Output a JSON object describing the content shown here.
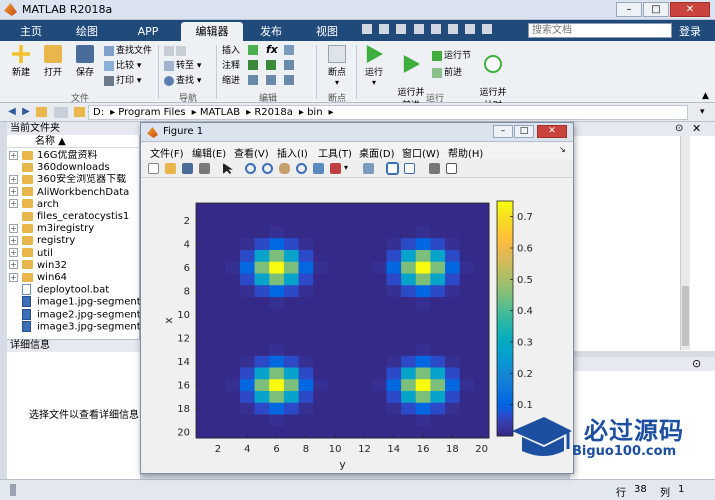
{
  "window": {
    "title": "MATLAB R2018a"
  },
  "tabs": [
    {
      "label": "主页",
      "active": false
    },
    {
      "label": "绘图",
      "active": false
    },
    {
      "label": "APP",
      "active": false
    },
    {
      "label": "编辑器",
      "active": true
    },
    {
      "label": "发布",
      "active": false
    },
    {
      "label": "视图",
      "active": false
    }
  ],
  "search": {
    "placeholder": "搜索文档"
  },
  "login": "登录",
  "ribbon": {
    "new": "新建",
    "open": "打开",
    "save": "保存",
    "find_files": "查找文件",
    "compare": "比较",
    "print": "打印",
    "goto": "转至",
    "find": "查找",
    "insert": "插入",
    "comment": "注释",
    "indent": "缩进",
    "breakpoints": "断点",
    "run": "运行",
    "run_advance": "运行并\n前进",
    "run_section": "运行节",
    "advance": "前进",
    "run_time": "运行并\n计时",
    "groups": {
      "file": "文件",
      "navigate": "导航",
      "edit": "编辑",
      "breakpoints": "断点",
      "run": "运行"
    }
  },
  "address": {
    "path": [
      "D:",
      "Program Files",
      "MATLAB",
      "R2018a",
      "bin"
    ]
  },
  "left_panel": {
    "title": "当前文件夹",
    "col_name": "名称 ▲",
    "items": [
      {
        "name": "16G优盘资料",
        "type": "folder",
        "expand": true
      },
      {
        "name": "360downloads",
        "type": "folder",
        "expand": false
      },
      {
        "name": "360安全浏览器下载",
        "type": "folder",
        "expand": true
      },
      {
        "name": "AliWorkbenchData",
        "type": "folder",
        "expand": true
      },
      {
        "name": "arch",
        "type": "folder",
        "expand": true
      },
      {
        "name": "files_ceratocystis1",
        "type": "folder",
        "expand": false
      },
      {
        "name": "m3iregistry",
        "type": "folder",
        "expand": true
      },
      {
        "name": "registry",
        "type": "folder",
        "expand": true
      },
      {
        "name": "util",
        "type": "folder",
        "expand": true
      },
      {
        "name": "win32",
        "type": "folder",
        "expand": true
      },
      {
        "name": "win64",
        "type": "folder",
        "expand": true
      },
      {
        "name": "deploytool.bat",
        "type": "file",
        "expand": false
      },
      {
        "name": "image1.jpg-segmente...",
        "type": "image",
        "expand": false
      },
      {
        "name": "image2.jpg-segmente...",
        "type": "image",
        "expand": false
      },
      {
        "name": "image3.jpg-segmente...",
        "type": "image",
        "expand": false
      }
    ]
  },
  "detail": {
    "title": "详细信息",
    "message": "选择文件以查看详细信息"
  },
  "status": {
    "row_label": "行",
    "row": "38",
    "col_label": "列",
    "col": "1"
  },
  "figure": {
    "title": "Figure 1",
    "menu": [
      "文件(F)",
      "编辑(E)",
      "查看(V)",
      "插入(I)",
      "工具(T)",
      "桌面(D)",
      "窗口(W)",
      "帮助(H)"
    ]
  },
  "chart_data": {
    "type": "heatmap",
    "xlabel": "y",
    "ylabel": "x",
    "xlim": [
      1,
      20
    ],
    "ylim": [
      1,
      20
    ],
    "xticks": [
      2,
      4,
      6,
      8,
      10,
      12,
      14,
      16,
      18,
      20
    ],
    "yticks": [
      2,
      4,
      6,
      8,
      10,
      12,
      14,
      16,
      18,
      20
    ],
    "colorbar_ticks": [
      0.1,
      0.2,
      0.3,
      0.4,
      0.5,
      0.6,
      0.7
    ],
    "clim": [
      0,
      0.75
    ],
    "peaks": [
      {
        "row": 6,
        "col": 6,
        "value": 0.75
      },
      {
        "row": 6,
        "col": 16,
        "value": 0.75
      },
      {
        "row": 16,
        "col": 6,
        "value": 0.75
      },
      {
        "row": 16,
        "col": 16,
        "value": 0.75
      }
    ],
    "sigma": 1.0
  },
  "watermark": {
    "text": "必过源码",
    "sub": "Biguo100.com"
  }
}
